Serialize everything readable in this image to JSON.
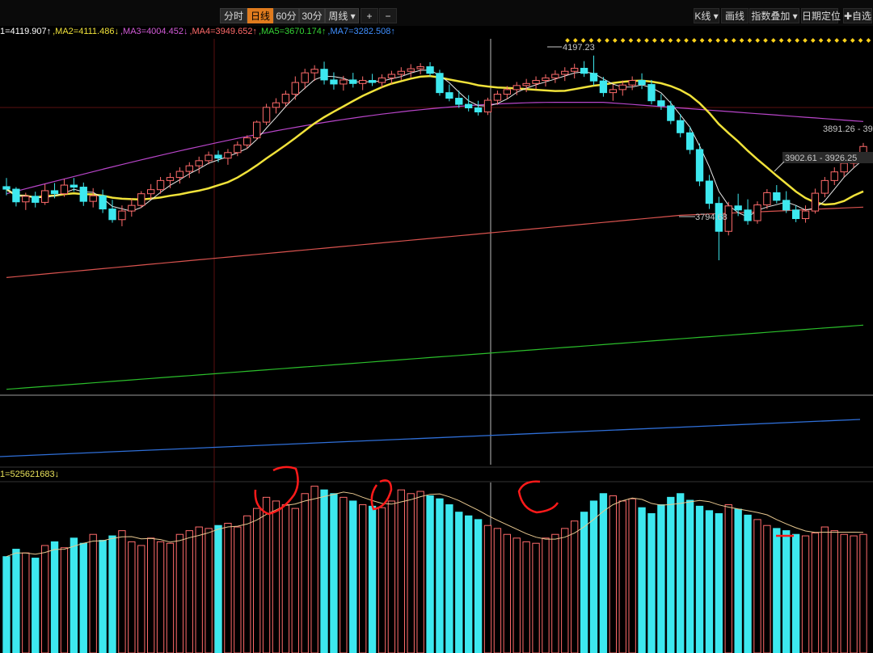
{
  "toolbar": {
    "left_buttons": [
      {
        "label": "分时",
        "active": false
      },
      {
        "label": "日线",
        "active": true
      },
      {
        "label": "60分",
        "active": false
      },
      {
        "label": "30分",
        "active": false
      },
      {
        "label": "周线 ▾",
        "active": false
      }
    ],
    "zoom_in": "+",
    "zoom_out": "−",
    "right_buttons": [
      {
        "label": "K线 ▾"
      },
      {
        "label": "画线"
      },
      {
        "label": "指数叠加 ▾"
      },
      {
        "label": "日期定位"
      },
      {
        "label": "✚自选"
      }
    ]
  },
  "ma_legend": [
    {
      "text": "1=4119.907↑",
      "color": "#ffffff"
    },
    {
      "text": ",MA2=4111.486↓",
      "color": "#f0e23a"
    },
    {
      "text": ",MA3=4004.452↓",
      "color": "#d35bd8"
    },
    {
      "text": ",MA4=3949.652↑",
      "color": "#ff6a6a"
    },
    {
      "text": ",MA5=3670.174↑",
      "color": "#35d435"
    },
    {
      "text": ",MA7=3282.508↑",
      "color": "#3f8fff"
    }
  ],
  "vol_legend": "1=525621683↓",
  "colors": {
    "up": "#ff6b6b",
    "down": "#3de8ef",
    "ma1": "#e8e8e8",
    "ma2": "#f0e23a",
    "ma3": "#b845c9",
    "ma4": "#d9534f",
    "ma5": "#2bbf2b",
    "ma7": "#2f6fd8",
    "annotation": "#ff1a1a",
    "grid": "#5a0f0f",
    "future_marker": "#ffd21a"
  },
  "chart_data": {
    "type": "candlestick",
    "price_labels": {
      "high": "4197.23",
      "low": "3794.68",
      "range1": "3891.26 - 39",
      "range2": "3902.61 - 3926.25"
    },
    "ylim": [
      3530,
      4230
    ],
    "candles": [
      [
        3939,
        3956,
        3922,
        3934
      ],
      [
        3934,
        3938,
        3900,
        3909
      ],
      [
        3909,
        3927,
        3893,
        3920
      ],
      [
        3920,
        3929,
        3898,
        3908
      ],
      [
        3908,
        3944,
        3903,
        3931
      ],
      [
        3931,
        3946,
        3916,
        3925
      ],
      [
        3925,
        3954,
        3919,
        3942
      ],
      [
        3942,
        3956,
        3929,
        3938
      ],
      [
        3938,
        3947,
        3901,
        3910
      ],
      [
        3910,
        3936,
        3898,
        3921
      ],
      [
        3921,
        3933,
        3887,
        3895
      ],
      [
        3895,
        3913,
        3868,
        3874
      ],
      [
        3874,
        3902,
        3861,
        3891
      ],
      [
        3891,
        3916,
        3880,
        3902
      ],
      [
        3902,
        3930,
        3897,
        3925
      ],
      [
        3925,
        3944,
        3914,
        3933
      ],
      [
        3933,
        3958,
        3925,
        3951
      ],
      [
        3951,
        3966,
        3936,
        3957
      ],
      [
        3957,
        3977,
        3945,
        3969
      ],
      [
        3969,
        3987,
        3956,
        3980
      ],
      [
        3980,
        3998,
        3965,
        3990
      ],
      [
        3990,
        4008,
        3983,
        4001
      ],
      [
        4001,
        4010,
        3987,
        3995
      ],
      [
        3995,
        4013,
        3982,
        4006
      ],
      [
        4006,
        4028,
        3999,
        4021
      ],
      [
        4021,
        4040,
        4013,
        4035
      ],
      [
        4035,
        4069,
        4031,
        4066
      ],
      [
        4066,
        4102,
        4060,
        4095
      ],
      [
        4095,
        4113,
        4083,
        4104
      ],
      [
        4104,
        4128,
        4097,
        4121
      ],
      [
        4121,
        4156,
        4110,
        4144
      ],
      [
        4144,
        4171,
        4131,
        4163
      ],
      [
        4163,
        4178,
        4147,
        4170
      ],
      [
        4170,
        4185,
        4140,
        4149
      ],
      [
        4149,
        4164,
        4130,
        4141
      ],
      [
        4141,
        4157,
        4128,
        4149
      ],
      [
        4149,
        4163,
        4134,
        4142
      ],
      [
        4142,
        4156,
        4129,
        4148
      ],
      [
        4148,
        4161,
        4137,
        4144
      ],
      [
        4144,
        4160,
        4134,
        4153
      ],
      [
        4153,
        4167,
        4141,
        4160
      ],
      [
        4160,
        4174,
        4149,
        4166
      ],
      [
        4166,
        4180,
        4154,
        4171
      ],
      [
        4171,
        4182,
        4160,
        4175
      ],
      [
        4175,
        4184,
        4156,
        4162
      ],
      [
        4162,
        4169,
        4118,
        4124
      ],
      [
        4124,
        4140,
        4107,
        4113
      ],
      [
        4113,
        4128,
        4094,
        4101
      ],
      [
        4101,
        4119,
        4087,
        4094
      ],
      [
        4094,
        4108,
        4079,
        4086
      ],
      [
        4086,
        4114,
        4080,
        4109
      ],
      [
        4109,
        4128,
        4100,
        4121
      ],
      [
        4121,
        4137,
        4111,
        4130
      ],
      [
        4130,
        4145,
        4119,
        4138
      ],
      [
        4138,
        4151,
        4125,
        4142
      ],
      [
        4142,
        4156,
        4131,
        4148
      ],
      [
        4148,
        4160,
        4136,
        4153
      ],
      [
        4153,
        4168,
        4143,
        4160
      ],
      [
        4160,
        4174,
        4147,
        4166
      ],
      [
        4166,
        4181,
        4152,
        4172
      ],
      [
        4172,
        4186,
        4155,
        4162
      ],
      [
        4162,
        4197,
        4138,
        4147
      ],
      [
        4147,
        4155,
        4116,
        4124
      ],
      [
        4124,
        4140,
        4108,
        4130
      ],
      [
        4130,
        4148,
        4118,
        4139
      ],
      [
        4139,
        4156,
        4129,
        4148
      ],
      [
        4148,
        4162,
        4131,
        4140
      ],
      [
        4140,
        4149,
        4101,
        4108
      ],
      [
        4108,
        4121,
        4090,
        4098
      ],
      [
        4098,
        4108,
        4062,
        4069
      ],
      [
        4069,
        4082,
        4036,
        4045
      ],
      [
        4045,
        4057,
        4003,
        4012
      ],
      [
        4012,
        4024,
        3940,
        3950
      ],
      [
        3950,
        3962,
        3895,
        3906
      ],
      [
        3906,
        3919,
        3794,
        3851
      ],
      [
        3851,
        3909,
        3843,
        3901
      ],
      [
        3901,
        3925,
        3881,
        3893
      ],
      [
        3893,
        3914,
        3864,
        3872
      ],
      [
        3872,
        3910,
        3866,
        3903
      ],
      [
        3903,
        3934,
        3895,
        3927
      ],
      [
        3927,
        3942,
        3906,
        3912
      ],
      [
        3912,
        3930,
        3887,
        3893
      ],
      [
        3893,
        3902,
        3869,
        3876
      ],
      [
        3876,
        3902,
        3868,
        3891
      ],
      [
        3891,
        3935,
        3886,
        3926
      ],
      [
        3926,
        3958,
        3918,
        3951
      ],
      [
        3951,
        3977,
        3942,
        3968
      ],
      [
        3968,
        3991,
        3958,
        3985
      ],
      [
        3985,
        4005,
        3976,
        3999
      ],
      [
        3999,
        4025,
        3990,
        4018
      ]
    ],
    "volume": {
      "ylim": [
        0,
        230
      ],
      "values": [
        130,
        140,
        135,
        128,
        145,
        150,
        142,
        155,
        148,
        160,
        152,
        158,
        165,
        150,
        145,
        155,
        150,
        148,
        160,
        165,
        170,
        168,
        172,
        175,
        170,
        185,
        195,
        210,
        205,
        200,
        195,
        215,
        225,
        220,
        215,
        210,
        205,
        200,
        198,
        196,
        205,
        220,
        215,
        218,
        212,
        208,
        200,
        190,
        185,
        180,
        172,
        168,
        160,
        155,
        150,
        148,
        155,
        160,
        168,
        178,
        190,
        205,
        215,
        212,
        205,
        208,
        196,
        188,
        200,
        210,
        215,
        206,
        198,
        192,
        188,
        200,
        194,
        186,
        180,
        172,
        168,
        165,
        160,
        158,
        162,
        170,
        165,
        160,
        158,
        160
      ]
    }
  }
}
